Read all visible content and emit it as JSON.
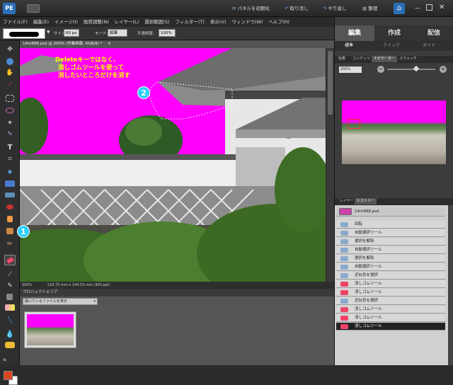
{
  "topbar": {
    "panel_reset": "パネルを初期化",
    "undo": "取り消し",
    "redo": "やり直し",
    "organize": "整理"
  },
  "menu": [
    "ファイル(F)",
    "編集(E)",
    "イメージ(I)",
    "画質調整(N)",
    "レイヤー(L)",
    "選択範囲(S)",
    "フィルター(T)",
    "表示(V)",
    "ウィンドウ(W)",
    "ヘルプ(H)"
  ],
  "options": {
    "size_label": "サイズ:",
    "size_value": "60 px",
    "mode_label": "モード:",
    "mode_value": "鉛筆",
    "opacity_label": "不透明度:",
    "opacity_value": "100%"
  },
  "document": {
    "tab_title": "14m888.psd @ 200% (作業画像, RGB/8) *",
    "annotation_lines": [
      "Deleteキーではなく、",
      "消しゴムツールを使って",
      "消したいところだけを消す"
    ],
    "marker_1": "1",
    "marker_2": "2",
    "zoom": "200%",
    "dimensions": "216.75 mm x 144.53 mm (300 ppi)"
  },
  "project_area": {
    "title": "プロジェクトエリア",
    "dropdown": "開いているファイルを表示"
  },
  "right_panel": {
    "tabs": [
      "編集",
      "作成",
      "配信"
    ],
    "subtabs": [
      "標準",
      "クイック",
      "ガイド"
    ],
    "palette_tabs": [
      "効果",
      "コンテンツ",
      "ナビゲーター",
      "スウォッチ"
    ],
    "nav_zoom": "200%",
    "lower_tabs": [
      "レイヤー",
      "ヒストリー"
    ],
    "history_file": "14m888.psd",
    "history": [
      "回転",
      "自動選択ツール",
      "選択を解除",
      "自動選択ツール",
      "選択を解除",
      "自動選択ツール",
      "近似色を選択",
      "消しゴムツール",
      "消しゴムツール",
      "近似色を選択",
      "消しゴムツール",
      "消しゴムツール",
      "消しゴムツール"
    ]
  },
  "colors": {
    "accent": "#4d8fd6",
    "magenta": "#ff00ff",
    "annotation": "#ffff00",
    "marker": "#00ffff"
  }
}
